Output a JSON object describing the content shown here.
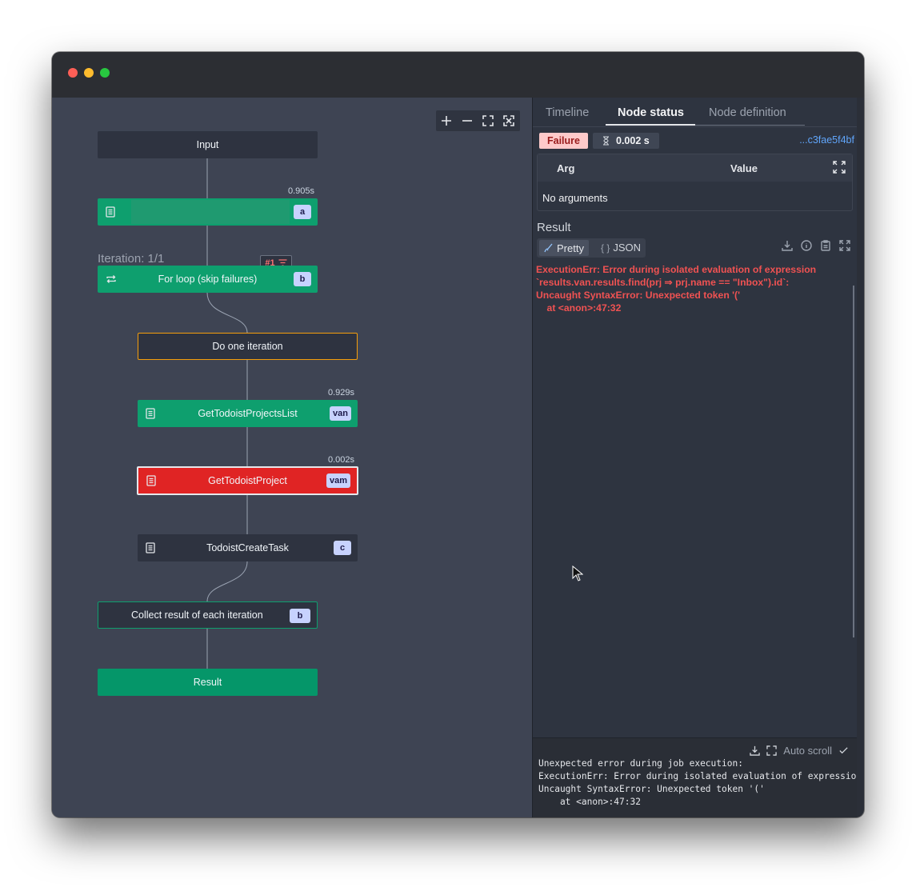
{
  "graph": {
    "nodes": {
      "input": {
        "label": "Input"
      },
      "step_a": {
        "label": "",
        "badge": "a",
        "timing": "0.905s"
      },
      "for_loop": {
        "label": "For loop (skip failures)",
        "badge": "b"
      },
      "do_one": {
        "label": "Do one iteration"
      },
      "get_list": {
        "label": "GetTodoistProjectsList",
        "badge": "van",
        "timing": "0.929s"
      },
      "get_project": {
        "label": "GetTodoistProject",
        "badge": "vam",
        "timing": "0.002s"
      },
      "create_task": {
        "label": "TodoistCreateTask",
        "badge": "c"
      },
      "collect": {
        "label": "Collect result of each iteration",
        "badge": "b"
      },
      "result": {
        "label": "Result"
      }
    },
    "iteration_label": "Iteration: 1/1",
    "iteration_chip": "#1"
  },
  "panel": {
    "tabs": [
      {
        "label": "Timeline"
      },
      {
        "label": "Node status"
      },
      {
        "label": "Node definition"
      }
    ],
    "status": "Failure",
    "duration": "0.002 s",
    "job_id": "...c3fae5f4bf",
    "args": {
      "col_arg": "Arg",
      "col_value": "Value",
      "empty": "No arguments"
    },
    "result": {
      "title": "Result",
      "view_pretty": "Pretty",
      "view_json": "JSON",
      "error": "ExecutionErr: Error during isolated evaluation of expression `results.van.results.find(prj ⇒ prj.name == \"Inbox\").id`:\nUncaught SyntaxError: Unexpected token '('\n    at <anon>:47:32"
    }
  },
  "logs": {
    "auto_scroll": "Auto scroll",
    "text": "Unexpected error during job execution:\nExecutionErr: Error during isolated evaluation of expression\nUncaught SyntaxError: Unexpected token '('\n    at <anon>:47:32"
  },
  "colors": {
    "success": "#0e9f6e",
    "failure": "#e02424",
    "running": "#f59e0b",
    "error_text": "#f05252",
    "link": "#60a5fa"
  }
}
